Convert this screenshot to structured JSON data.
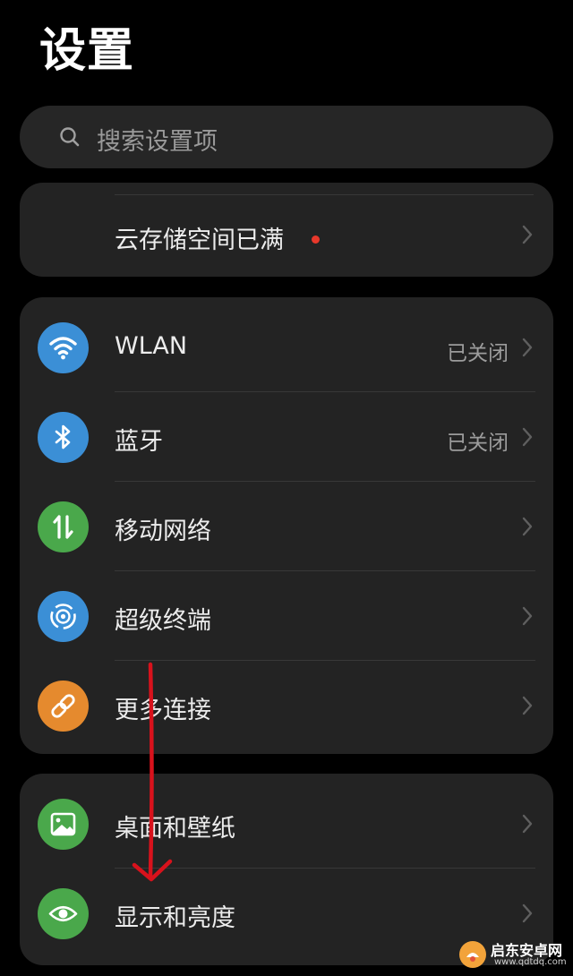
{
  "page": {
    "title": "设置"
  },
  "search": {
    "placeholder": "搜索设置项",
    "icon": "search-icon"
  },
  "cloud": {
    "label": "云存储空间已满",
    "badge_color": "#e8382b"
  },
  "network_group": [
    {
      "label": "WLAN",
      "status": "已关闭",
      "icon": "wifi-icon",
      "color": "#3b8fd6"
    },
    {
      "label": "蓝牙",
      "status": "已关闭",
      "icon": "bluetooth-icon",
      "color": "#3b8fd6"
    },
    {
      "label": "移动网络",
      "status": "",
      "icon": "mobile-data-icon",
      "color": "#4aa84b"
    },
    {
      "label": "超级终端",
      "status": "",
      "icon": "super-device-icon",
      "color": "#3b8fd6"
    },
    {
      "label": "更多连接",
      "status": "",
      "icon": "link-icon",
      "color": "#e58a2e"
    }
  ],
  "display_group": [
    {
      "label": "桌面和壁纸",
      "icon": "wallpaper-icon",
      "color": "#4aa84b"
    },
    {
      "label": "显示和亮度",
      "icon": "eye-icon",
      "color": "#4aa84b"
    }
  ],
  "annotation": {
    "arrow_color": "#d8121c"
  },
  "watermark": {
    "name": "启东安卓网",
    "url": "www.qdtdq.com"
  }
}
